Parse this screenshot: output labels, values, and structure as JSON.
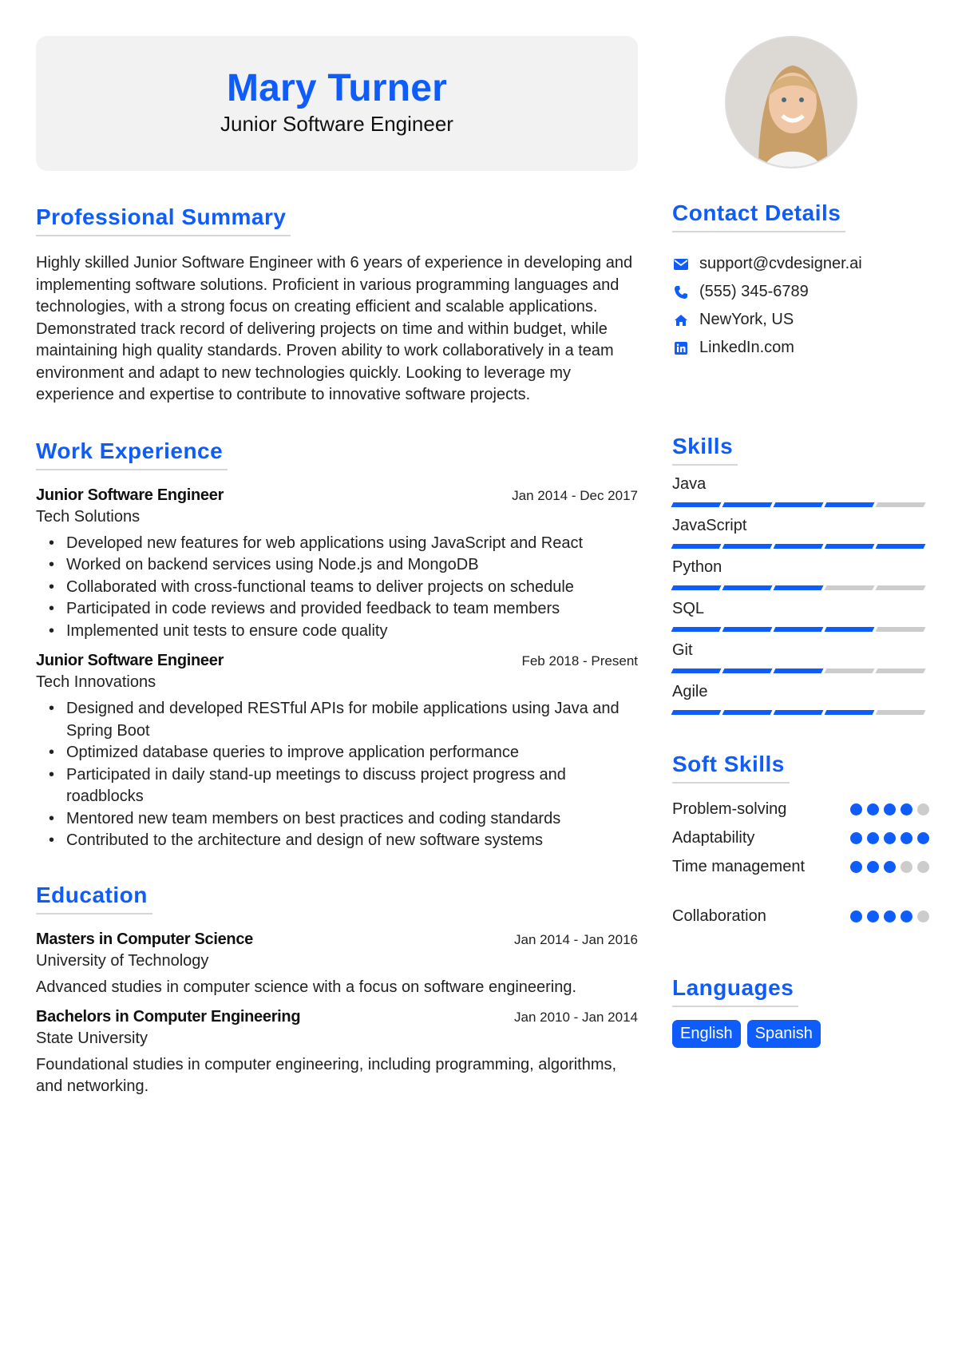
{
  "header": {
    "name": "Mary Turner",
    "title": "Junior Software Engineer"
  },
  "colors": {
    "accent": "#0e5cf9",
    "header_bg": "#f2f2f2",
    "inactive": "#cccccc"
  },
  "summary": {
    "heading": "Professional Summary",
    "text": "Highly skilled Junior Software Engineer with 6 years of experience in developing and implementing software solutions. Proficient in various programming languages and technologies, with a strong focus on creating efficient and scalable applications. Demonstrated track record of delivering projects on time and within budget, while maintaining high quality standards. Proven ability to work collaboratively in a team environment and adapt to new technologies quickly. Looking to leverage my experience and expertise to contribute to innovative software projects."
  },
  "work": {
    "heading": "Work Experience",
    "entries": [
      {
        "title": "Junior Software Engineer",
        "company": "Tech Solutions",
        "dates": "Jan 2014 - Dec 2017",
        "bullets": [
          "Developed new features for web applications using JavaScript and React",
          "Worked on backend services using Node.js and MongoDB",
          "Collaborated with cross-functional teams to deliver projects on schedule",
          "Participated in code reviews and provided feedback to team members",
          "Implemented unit tests to ensure code quality"
        ]
      },
      {
        "title": "Junior Software Engineer",
        "company": "Tech Innovations",
        "dates": "Feb 2018 - Present",
        "bullets": [
          "Designed and developed RESTful APIs for mobile applications using Java and Spring Boot",
          "Optimized database queries to improve application performance",
          "Participated in daily stand-up meetings to discuss project progress and roadblocks",
          "Mentored new team members on best practices and coding standards",
          "Contributed to the architecture and design of new software systems"
        ]
      }
    ]
  },
  "education": {
    "heading": "Education",
    "entries": [
      {
        "degree": "Masters in Computer Science",
        "school": "University of Technology",
        "dates": "Jan 2014 - Jan 2016",
        "description": "Advanced studies in computer science with a focus on software engineering."
      },
      {
        "degree": "Bachelors in Computer Engineering",
        "school": "State University",
        "dates": "Jan 2010 - Jan 2014",
        "description": "Foundational studies in computer engineering, including programming, algorithms, and networking."
      }
    ]
  },
  "photo": {
    "alt": "Profile photo"
  },
  "contact": {
    "heading": "Contact Details",
    "items": [
      {
        "icon": "envelope-icon",
        "text": "support@cvdesigner.ai"
      },
      {
        "icon": "phone-icon",
        "text": "(555) 345-6789"
      },
      {
        "icon": "home-icon",
        "text": "NewYork, US"
      },
      {
        "icon": "linkedin-icon",
        "text": "LinkedIn.com"
      }
    ]
  },
  "skills": {
    "heading": "Skills",
    "max_level": 5,
    "items": [
      {
        "name": "Java",
        "level": 4
      },
      {
        "name": "JavaScript",
        "level": 5
      },
      {
        "name": "Python",
        "level": 3
      },
      {
        "name": "SQL",
        "level": 4
      },
      {
        "name": "Git",
        "level": 3
      },
      {
        "name": "Agile",
        "level": 4
      }
    ]
  },
  "soft_skills": {
    "heading": "Soft Skills",
    "max_level": 5,
    "items": [
      {
        "name": "Problem-solving",
        "level": 4
      },
      {
        "name": "Adaptability",
        "level": 5
      },
      {
        "name": "Time management",
        "level": 3
      },
      {
        "name": "Collaboration",
        "level": 4
      }
    ]
  },
  "languages": {
    "heading": "Languages",
    "items": [
      "English",
      "Spanish"
    ]
  }
}
